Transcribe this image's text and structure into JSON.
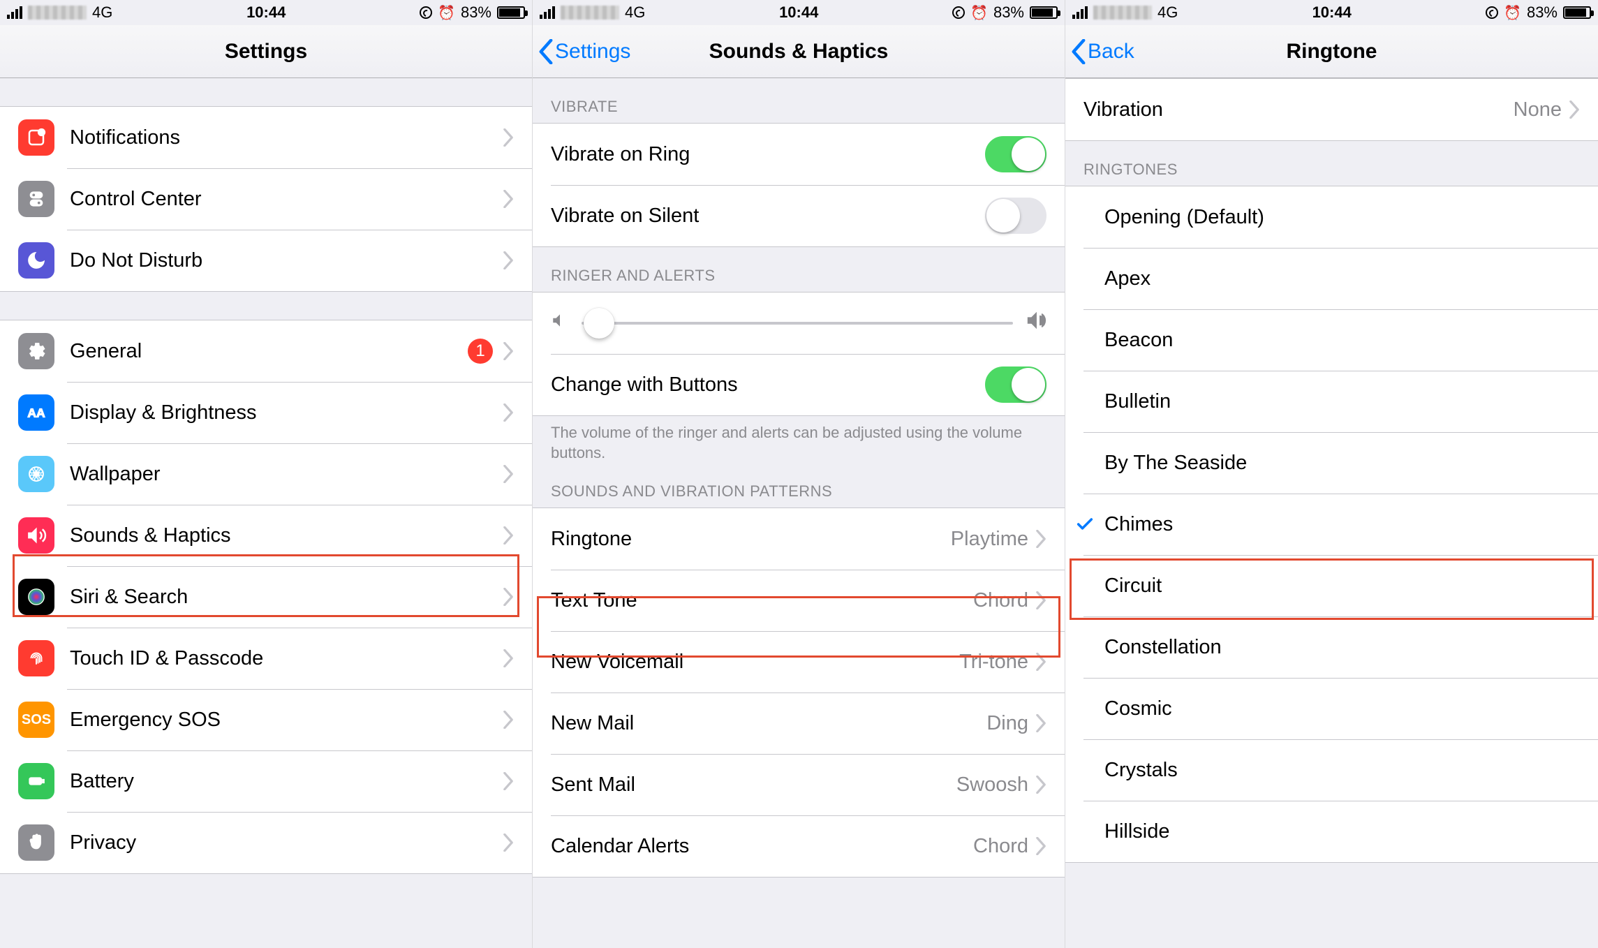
{
  "status": {
    "network": "4G",
    "time": "10:44",
    "battery_pct": "83%"
  },
  "screen1": {
    "title": "Settings",
    "groupA": [
      {
        "name": "notifications",
        "label": "Notifications",
        "color": "ic-red"
      },
      {
        "name": "control-center",
        "label": "Control Center",
        "color": "ic-gray"
      },
      {
        "name": "do-not-disturb",
        "label": "Do Not Disturb",
        "color": "ic-purple"
      }
    ],
    "groupB": [
      {
        "name": "general",
        "label": "General",
        "color": "ic-gray",
        "badge": "1"
      },
      {
        "name": "display-brightness",
        "label": "Display & Brightness",
        "color": "ic-blue"
      },
      {
        "name": "wallpaper",
        "label": "Wallpaper",
        "color": "ic-lightblue"
      },
      {
        "name": "sounds-haptics",
        "label": "Sounds & Haptics",
        "color": "ic-pink",
        "highlighted": true
      },
      {
        "name": "siri-search",
        "label": "Siri & Search",
        "color": "ic-black"
      },
      {
        "name": "touch-id-passcode",
        "label": "Touch ID & Passcode",
        "color": "ic-red"
      },
      {
        "name": "emergency-sos",
        "label": "Emergency SOS",
        "color": "ic-orange",
        "sos": true
      },
      {
        "name": "battery",
        "label": "Battery",
        "color": "ic-green"
      },
      {
        "name": "privacy",
        "label": "Privacy",
        "color": "ic-gray"
      }
    ]
  },
  "screen2": {
    "back": "Settings",
    "title": "Sounds & Haptics",
    "sec_vibrate": "VIBRATE",
    "vibrate_ring": "Vibrate on Ring",
    "vibrate_silent": "Vibrate on Silent",
    "sec_ringer": "RINGER AND ALERTS",
    "change_buttons": "Change with Buttons",
    "footer": "The volume of the ringer and alerts can be adjusted using the volume buttons.",
    "sec_sounds": "SOUNDS AND VIBRATION PATTERNS",
    "rows": [
      {
        "name": "ringtone",
        "label": "Ringtone",
        "value": "Playtime",
        "highlighted": true
      },
      {
        "name": "text-tone",
        "label": "Text Tone",
        "value": "Chord"
      },
      {
        "name": "new-voicemail",
        "label": "New Voicemail",
        "value": "Tri-tone"
      },
      {
        "name": "new-mail",
        "label": "New Mail",
        "value": "Ding"
      },
      {
        "name": "sent-mail",
        "label": "Sent Mail",
        "value": "Swoosh"
      },
      {
        "name": "calendar-alerts",
        "label": "Calendar Alerts",
        "value": "Chord"
      }
    ]
  },
  "screen3": {
    "back": "Back",
    "title": "Ringtone",
    "vibration_label": "Vibration",
    "vibration_value": "None",
    "sec_ringtones": "RINGTONES",
    "tones": [
      {
        "label": "Opening (Default)"
      },
      {
        "label": "Apex"
      },
      {
        "label": "Beacon"
      },
      {
        "label": "Bulletin"
      },
      {
        "label": "By The Seaside"
      },
      {
        "label": "Chimes",
        "checked": true,
        "highlighted": true
      },
      {
        "label": "Circuit"
      },
      {
        "label": "Constellation"
      },
      {
        "label": "Cosmic"
      },
      {
        "label": "Crystals"
      },
      {
        "label": "Hillside"
      }
    ]
  }
}
